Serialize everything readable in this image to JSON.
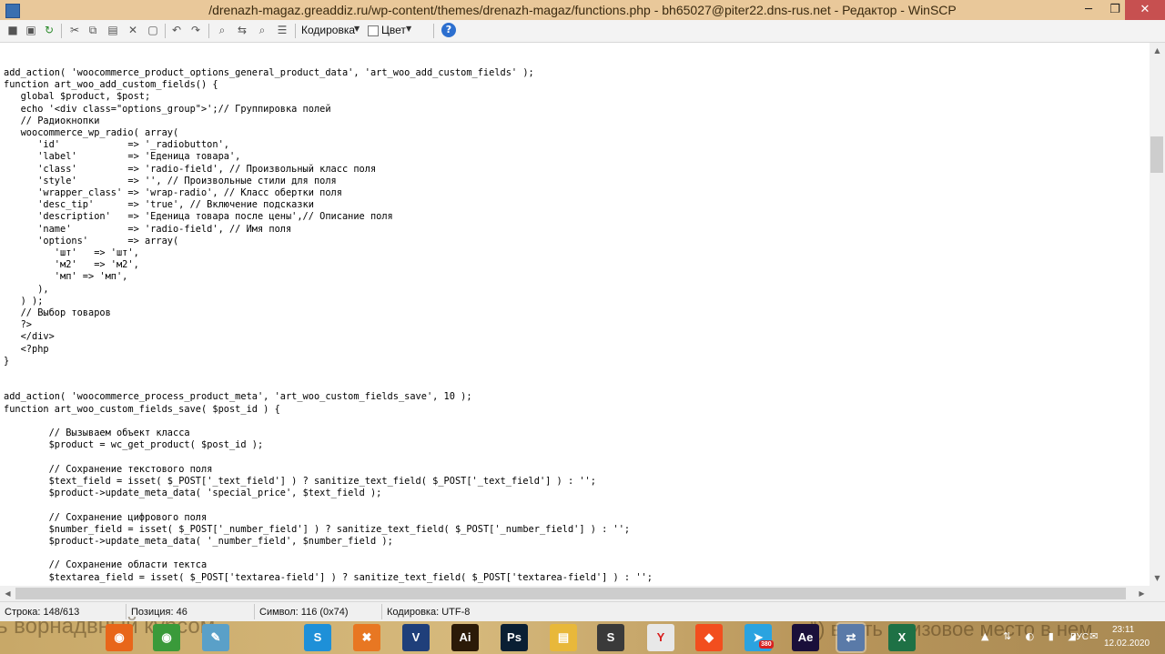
{
  "window": {
    "title": "/drenazh-magaz.greaddiz.ru/wp-content/themes/drenazh-magaz/functions.php - bh65027@piter22.dns-rus.net - Редактор - WinSCP",
    "minimize_glyph": "─",
    "maximize_glyph": "❐",
    "close_glyph": "✕"
  },
  "toolbar": {
    "encoding_label": "Кодировка",
    "color_label": "Цвет",
    "help_glyph": "?",
    "dropdown_glyph": "▼"
  },
  "editor": {
    "code": "add_action( 'woocommerce_product_options_general_product_data', 'art_woo_add_custom_fields' );\nfunction art_woo_add_custom_fields() {\n   global $product, $post;\n   echo '<div class=\"options_group\">';// Группировка полей\n   // Радиокнопки\n   woocommerce_wp_radio( array(\n      'id'            => '_radiobutton',\n      'label'         => 'Еденица товара',\n      'class'         => 'radio-field', // Произвольный класс поля\n      'style'         => '', // Произвольные стили для поля\n      'wrapper_class' => 'wrap-radio', // Класс обертки поля\n      'desc_tip'      => 'true', // Включение подсказки\n      'description'   => 'Еденица товара после цены',// Описание поля\n      'name'          => 'radio-field', // Имя поля\n      'options'       => array(\n         'шт'   => 'шт',\n         'м2'   => 'м2',\n         'мп' => 'мп',\n      ),\n   ) );\n   // Выбор товаров\n   ?>\n   </div>\n   <?php\n}\n\n\nadd_action( 'woocommerce_process_product_meta', 'art_woo_custom_fields_save', 10 );\nfunction art_woo_custom_fields_save( $post_id ) {\n\n\t// Вызываем объект класса\n\t$product = wc_get_product( $post_id );\n\n\t// Сохранение текстового поля\n\t$text_field = isset( $_POST['_text_field'] ) ? sanitize_text_field( $_POST['_text_field'] ) : '';\n\t$product->update_meta_data( 'special_price', $text_field );\n\n\t// Сохранение цифрового поля\n\t$number_field = isset( $_POST['_number_field'] ) ? sanitize_text_field( $_POST['_number_field'] ) : '';\n\t$product->update_meta_data( '_number_field', $number_field );\n\n\t// Сохранение области тектса\n\t$textarea_field = isset( $_POST['textarea-field'] ) ? sanitize_text_field( $_POST['textarea-field'] ) : '';"
  },
  "status": {
    "line": "Строка: 148/613",
    "position": "Позиция: 46",
    "symbol": "Символ: 116 (0x74)",
    "encoding": "Кодировка: UTF-8"
  },
  "taskbar": {
    "wallpaper_text_left": "ь ворнадвный курсом",
    "wallpaper_text_right": "” ) внять призовое место в нем",
    "apps": [
      {
        "name": "firefox",
        "glyph": "◉",
        "color": "#e8661a"
      },
      {
        "name": "chrome",
        "glyph": "◉",
        "color": "#3a9a3a"
      },
      {
        "name": "paint",
        "glyph": "✎",
        "color": "#5aa0c8"
      },
      {
        "name": "skype",
        "glyph": "S",
        "color": "#1e90d8"
      },
      {
        "name": "xampp",
        "glyph": "✖",
        "color": "#e87722"
      },
      {
        "name": "visual-studio",
        "glyph": "V",
        "color": "#1f3f7a"
      },
      {
        "name": "illustrator",
        "glyph": "Ai",
        "color": "#2b1a08"
      },
      {
        "name": "photoshop",
        "glyph": "Ps",
        "color": "#0a1f33"
      },
      {
        "name": "file-explorer",
        "glyph": "▤",
        "color": "#e8b83a"
      },
      {
        "name": "sublime-text",
        "glyph": "S",
        "color": "#3a3a3a"
      },
      {
        "name": "yandex-browser",
        "glyph": "Y",
        "color": "#e8e8e8"
      },
      {
        "name": "figma",
        "glyph": "◆",
        "color": "#f24e1e"
      },
      {
        "name": "telegram",
        "glyph": "➤",
        "color": "#2aa3e0"
      },
      {
        "name": "after-effects",
        "glyph": "Ae",
        "color": "#1a0f3a"
      },
      {
        "name": "winscp",
        "glyph": "⇄",
        "color": "#5a7aa8"
      },
      {
        "name": "excel",
        "glyph": "X",
        "color": "#1e7145"
      }
    ],
    "telegram_badge": "380",
    "language": "РУС",
    "time": "23:11",
    "date": "12.02.2020"
  }
}
